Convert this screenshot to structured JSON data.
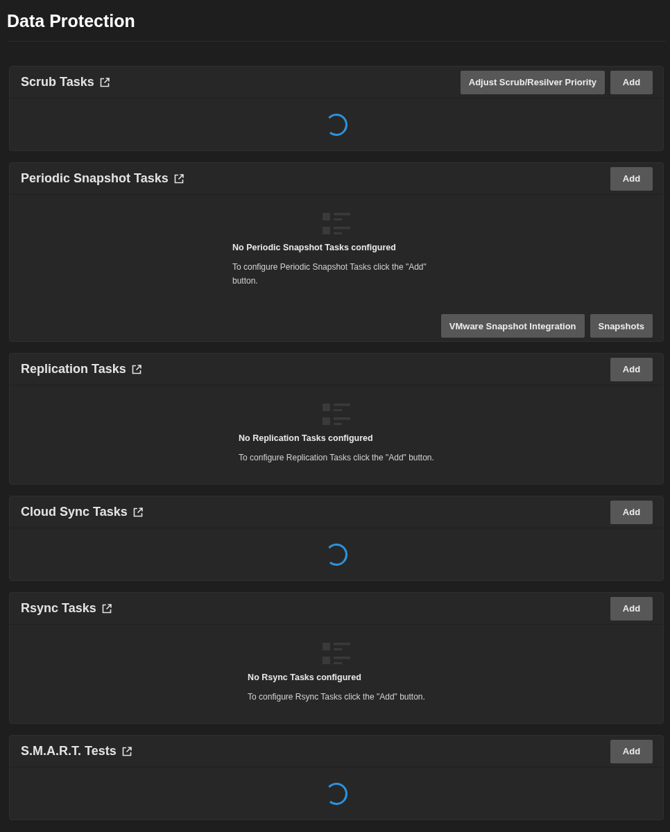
{
  "page": {
    "title": "Data Protection"
  },
  "sections": [
    {
      "kind": "loading",
      "title": "Scrub Tasks",
      "header_buttons": [
        "Adjust Scrub/Resilver Priority",
        "Add"
      ]
    },
    {
      "kind": "empty",
      "title": "Periodic Snapshot Tasks",
      "header_buttons": [
        "Add"
      ],
      "empty_title": "No Periodic Snapshot Tasks configured",
      "empty_message": "To configure Periodic Snapshot Tasks click the \"Add\" button.",
      "footer_buttons": [
        "VMware Snapshot Integration",
        "Snapshots"
      ]
    },
    {
      "kind": "empty",
      "title": "Replication Tasks",
      "header_buttons": [
        "Add"
      ],
      "empty_title": "No Replication Tasks configured",
      "empty_message": "To configure Replication Tasks click the \"Add\" button."
    },
    {
      "kind": "loading",
      "title": "Cloud Sync Tasks",
      "header_buttons": [
        "Add"
      ]
    },
    {
      "kind": "empty",
      "title": "Rsync Tasks",
      "header_buttons": [
        "Add"
      ],
      "empty_title": "No Rsync Tasks configured",
      "empty_message": "To configure Rsync Tasks click the \"Add\" button."
    },
    {
      "kind": "loading",
      "title": "S.M.A.R.T. Tests",
      "header_buttons": [
        "Add"
      ]
    }
  ]
}
